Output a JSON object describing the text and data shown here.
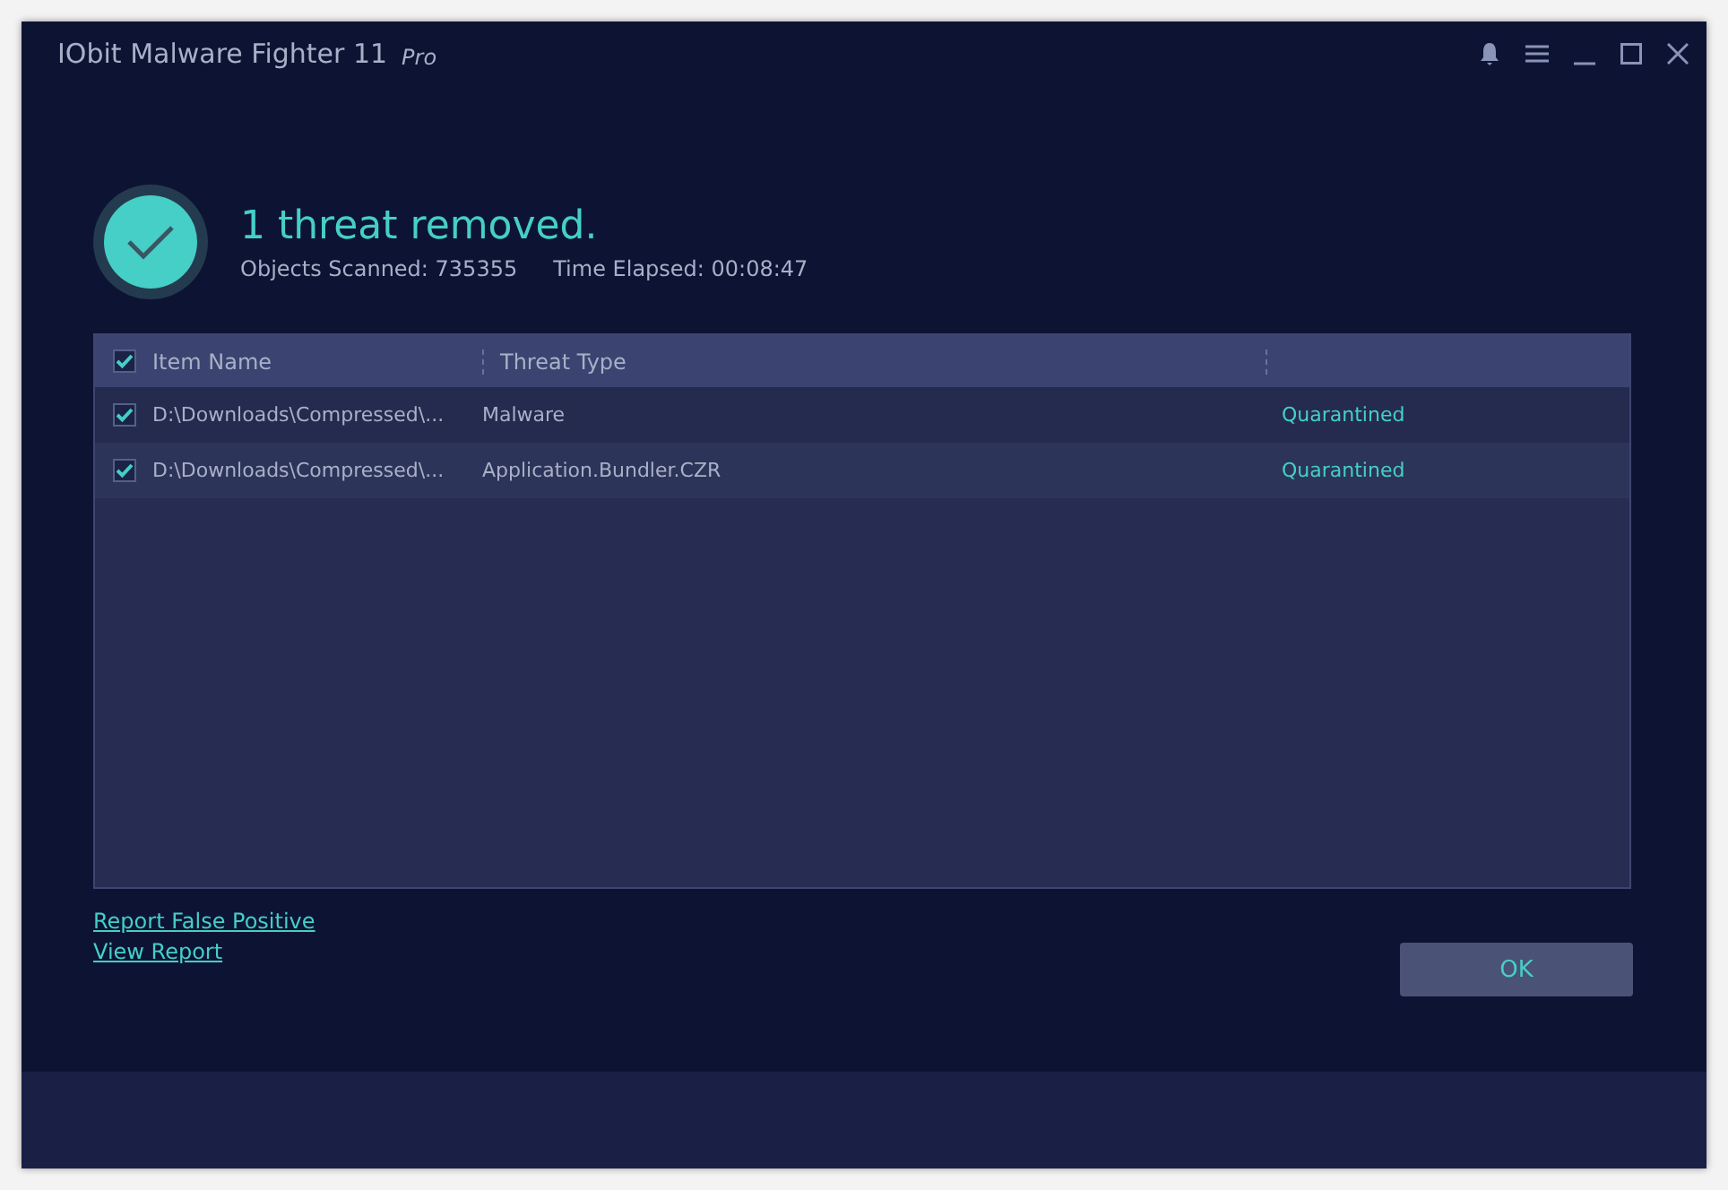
{
  "window": {
    "title": "IObit Malware Fighter 11",
    "edition": "Pro"
  },
  "summary": {
    "headline": "1 threat removed.",
    "objects_scanned": "Objects Scanned: 735355",
    "time_elapsed": "Time Elapsed: 00:08:47"
  },
  "table": {
    "select_all_checked": true,
    "columns": [
      "Item Name",
      "Threat Type"
    ],
    "rows": [
      {
        "checked": true,
        "item_name": "D:\\Downloads\\Compressed\\...",
        "threat_type": "Malware",
        "status": "Quarantined"
      },
      {
        "checked": true,
        "item_name": "D:\\Downloads\\Compressed\\...",
        "threat_type": "Application.Bundler.CZR",
        "status": "Quarantined"
      }
    ]
  },
  "links": [
    "Report False Positive",
    "View Report"
  ],
  "ok_button": "OK"
}
